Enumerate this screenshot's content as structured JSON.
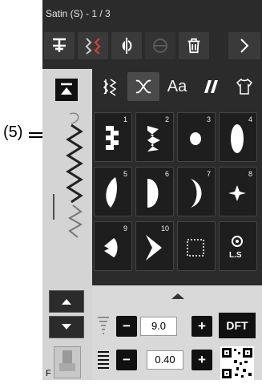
{
  "title": "Satin (S) - 1 / 3",
  "callout": "(5)",
  "colors": {
    "screen": "#2b2b2b",
    "panel": "#d4d4d4",
    "accent_tab": "#4a4a4a"
  },
  "toolbar": [
    "needle-position-icon",
    "mirror-pattern-icon",
    "flip-icon",
    "disabled-icon",
    "delete-icon",
    "next-arrow-icon"
  ],
  "category_tabs": [
    "buttonhole-tab",
    "satin-tab",
    "alphabet-tab",
    "quilt-tab",
    "shirt-tab"
  ],
  "selected_category": "satin-tab",
  "patterns": [
    "1",
    "2",
    "3",
    "4",
    "5",
    "6",
    "7",
    "8",
    "9",
    "10"
  ],
  "extra_tile_label": "L.S",
  "controls": {
    "width_value": "9.0",
    "length_value": "0.40",
    "dft_label": "DFT"
  },
  "left_panel_bottom_label": "F"
}
